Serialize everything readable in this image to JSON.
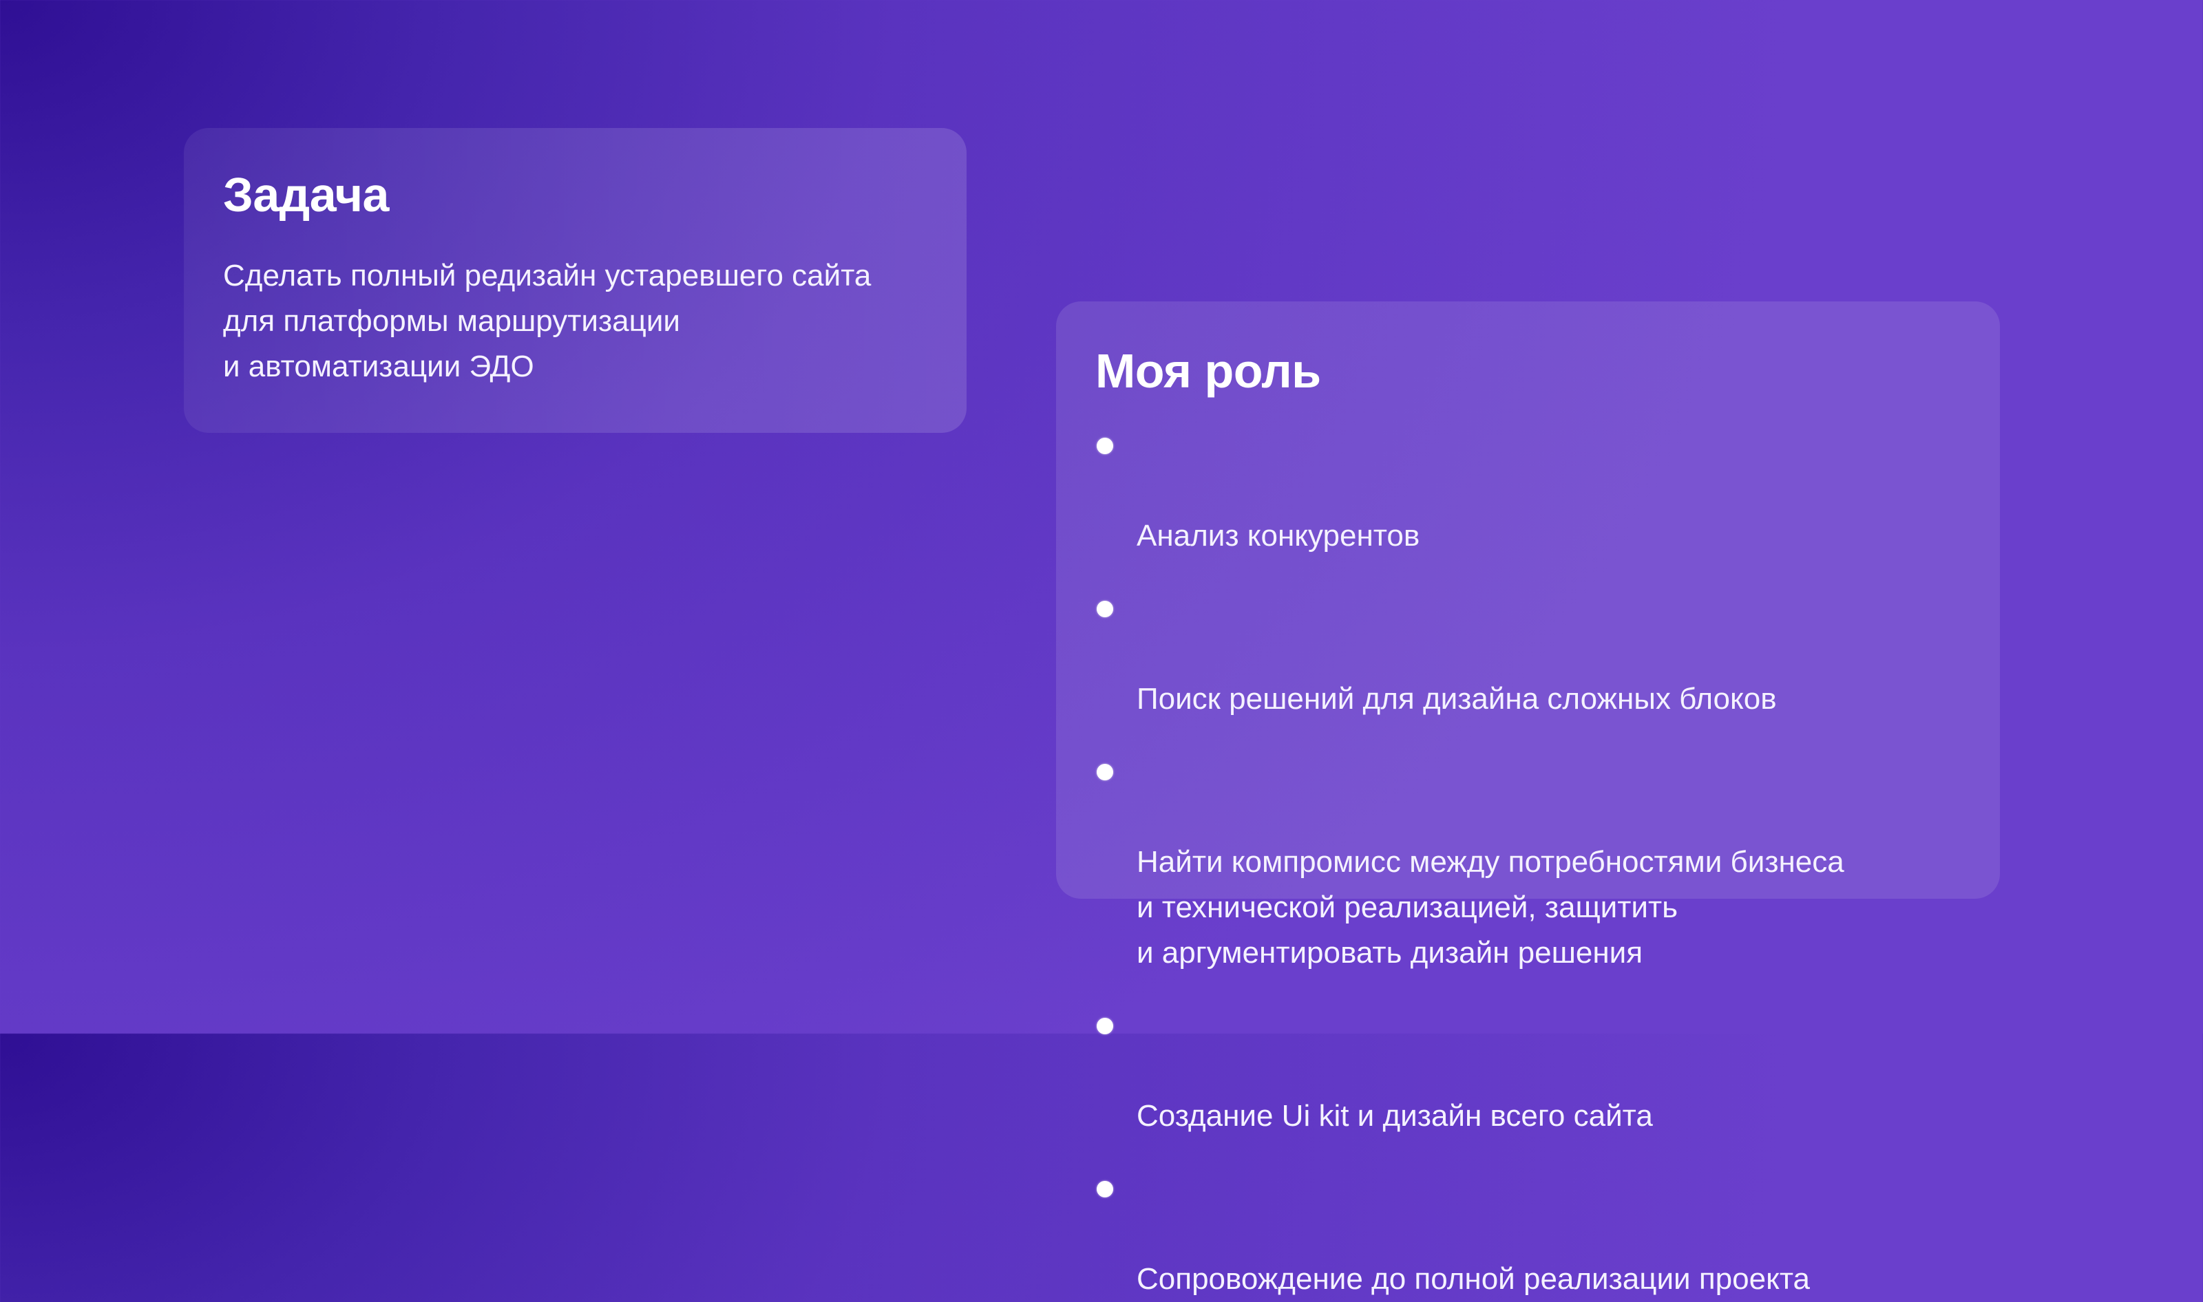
{
  "task_card": {
    "title": "Задача",
    "text": "Сделать полный редизайн устаревшего сайта\nдля платформы маршрутизации\nи автоматизации ЭДО"
  },
  "role_card": {
    "title": "Моя роль",
    "items": [
      {
        "label": "Анализ конкурентов"
      },
      {
        "label": "Поиск решений для дизайна сложных блоков"
      },
      {
        "label": "Найти компромисс между потребностями бизнеса\nи технической реализацией, защитить\nи аргументировать дизайн решения"
      },
      {
        "label": "Создание Ui kit и дизайн всего сайта"
      },
      {
        "label": "Сопровождение до полной реализации проекта"
      }
    ]
  },
  "colors": {
    "background_dark": "#2f0f94",
    "background_light": "#6a3fcc",
    "text": "#ffffff"
  }
}
